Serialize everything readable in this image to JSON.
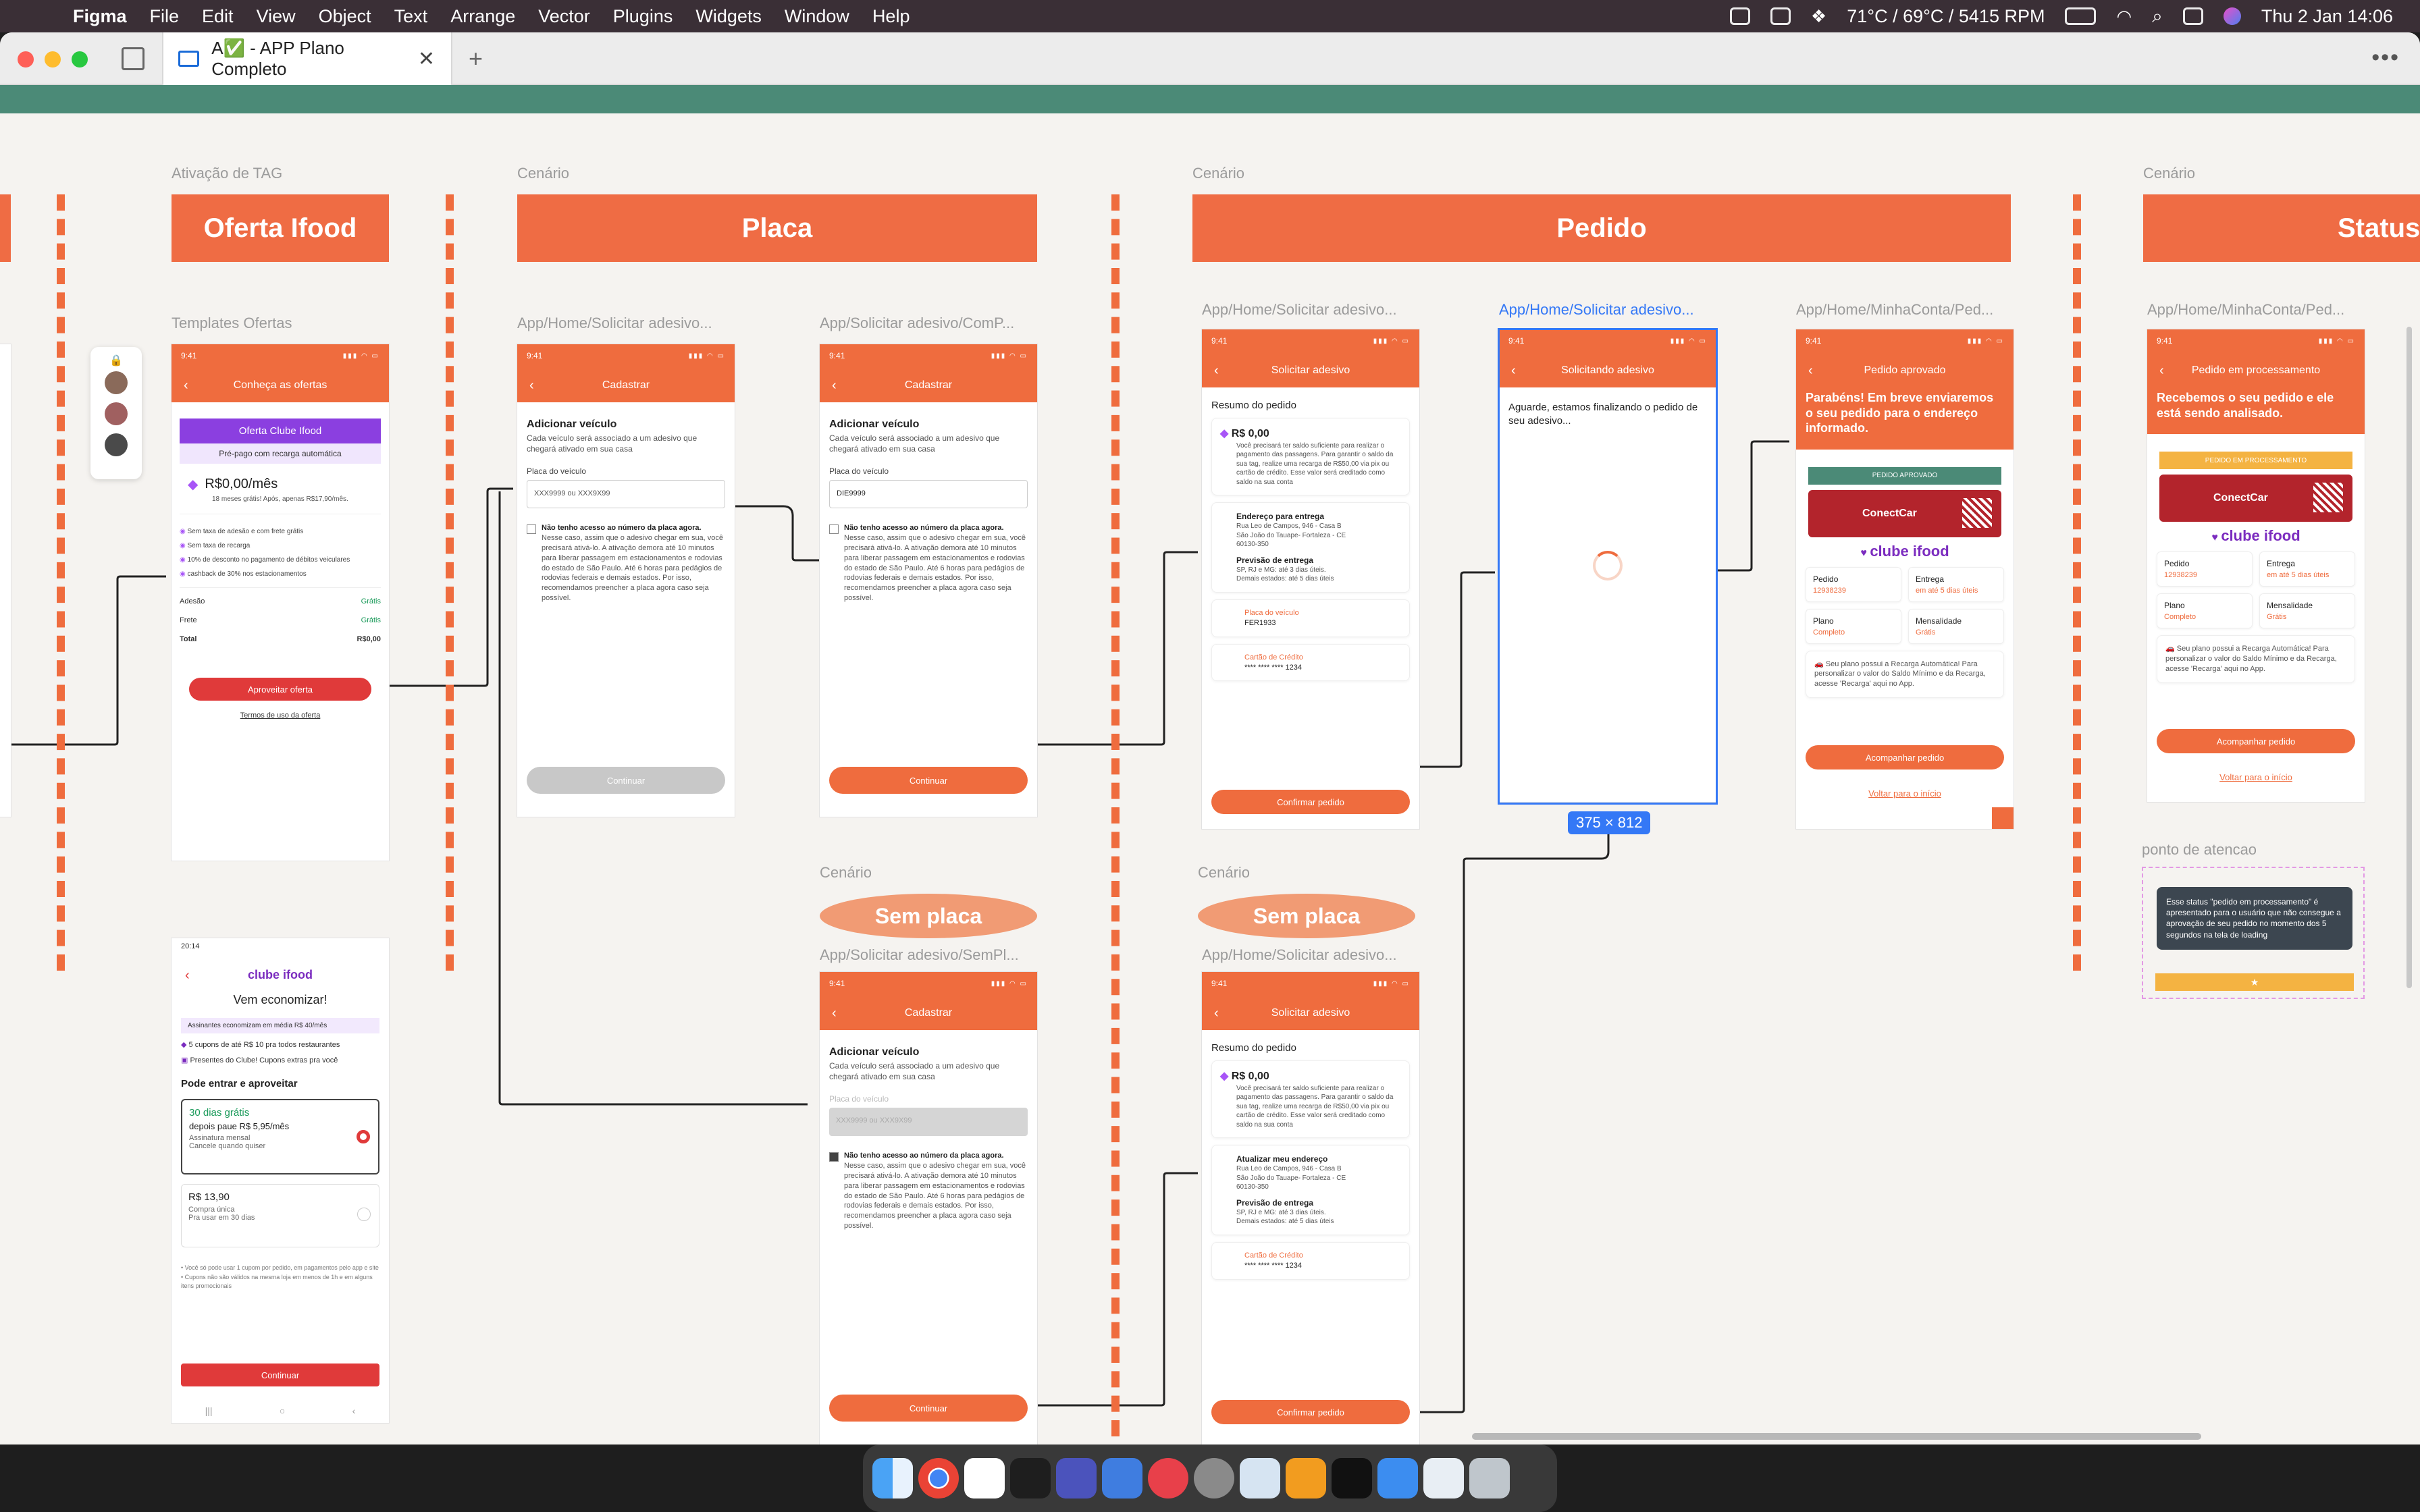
{
  "menubar": {
    "app": "Figma",
    "items": [
      "File",
      "Edit",
      "View",
      "Object",
      "Text",
      "Arrange",
      "Vector",
      "Plugins",
      "Widgets",
      "Window",
      "Help"
    ],
    "temp": "71°C / 69°C / 5415 RPM",
    "datetime": "Thu 2 Jan  14:06"
  },
  "tab": {
    "title": "A✅ - APP Plano Completo"
  },
  "sections": {
    "ativacao_label": "Ativação de TAG",
    "cenario": "Cenário",
    "oferta": "Oferta Ifood",
    "placa": "Placa",
    "pedido": "Pedido",
    "status": "Status do P",
    "sem_placa": "Sem placa",
    "templates": "Templates Ofertas",
    "ponto": "ponto de atencao"
  },
  "frames": {
    "f1": "App/Home/Solicitar adesivo...",
    "f2": "App/Solicitar adesivo/ComP...",
    "f3": "App/Home/Solicitar adesivo...",
    "f4": "App/Home/Solicitar adesivo...",
    "f5": "App/Home/MinhaConta/Ped...",
    "f6": "App/Home/MinhaConta/Ped...",
    "f7": "App/Solicitar adesivo/SemPl...",
    "f8": "App/Home/Solicitar adesivo...",
    "dims": "375 × 812"
  },
  "oferta": {
    "time": "9:41",
    "title": "Conheça as ofertas",
    "banner": "Oferta Clube Ifood",
    "sub": "Pré-pago com recarga automática",
    "price": "R$0,00/mês",
    "price_note": "18 meses grátis! Após, apenas R$17,90/mês.",
    "benefits": [
      "Sem taxa de adesão e com frete grátis",
      "Sem taxa de recarga",
      "10% de desconto no pagamento de débitos veiculares",
      "cashback de 30% nos estacionamentos"
    ],
    "adesao": "Adesão",
    "adesao_v": "Grátis",
    "frete": "Frete",
    "frete_v": "Grátis",
    "total": "Total",
    "total_v": "R$0,00",
    "cta": "Aproveitar oferta",
    "terms": "Termos de uso da oferta"
  },
  "clube": {
    "time": "20:14",
    "logo": "clube ifood",
    "title": "Vem economizar!",
    "saving": "Assinantes economizam em média R$ 40/mês",
    "b1": "5 cupons de até R$ 10 pra todos restaurantes",
    "b2": "Presentes do Clube! Cupons extras pra você",
    "section": "Pode entrar e aproveitar",
    "opt1_t": "30 dias grátis",
    "opt1_s": "depois paue R$ 5,95/mês",
    "opt1_d": "Assinatura mensal\nCancele quando quiser",
    "opt2_t": "R$ 13,90",
    "opt2_d": "Compra única\nPra usar em 30 dias",
    "fine": "• Você só pode usar 1 cupom por pedido, em pagamentos pelo app e site\n• Cupons não são válidos na mesma loja em menos de 1h e em alguns itens promocionais",
    "cta": "Continuar"
  },
  "cadastro": {
    "time": "9:41",
    "title": "Cadastrar",
    "h": "Adicionar veículo",
    "desc": "Cada veículo será associado a um adesivo que chegará ativado em sua casa",
    "field": "Placa do veículo",
    "ph": "XXX9999 ou XXX9X99",
    "val": "DIE9999",
    "chk_b": "Não tenho acesso ao número da placa agora.",
    "chk_t": "Nesse caso, assim que o adesivo chegar em sua, você precisará ativá-lo. A ativação demora até 10 minutos para liberar passagem em estacionamentos e rodovias do estado de São Paulo. Até 6 horas para pedágios de rodovias federais e demais estados. Por isso, recomendamos preencher a placa agora caso seja possível.",
    "cta": "Continuar"
  },
  "resumo": {
    "time": "9:41",
    "title": "Solicitar adesivo",
    "h": "Resumo do pedido",
    "price": "R$ 0,00",
    "price_t": "Você precisará ter saldo suficiente para realizar o pagamento das passagens. Para garantir o saldo da sua tag, realize uma recarga de R$50,00 via pix ou cartão de crédito. Esse valor será creditado como saldo na sua conta",
    "end_t": "Endereço para entrega",
    "end_t2": "Atualizar meu endereço",
    "end": "Rua Leo de Campos, 946 - Casa B\nSão João do Tauape- Fortaleza - CE\n60130-350",
    "prev_t": "Previsão de entrega",
    "prev": "SP, RJ e MG: até 3 dias úteis.\nDemais estados: até 5 dias úteis",
    "placa_t": "Placa do veículo",
    "placa": "FER1933",
    "cartao_t": "Cartão de Crédito",
    "cartao": "**** **** **** 1234",
    "cta": "Confirmar pedido"
  },
  "loading": {
    "time": "9:41",
    "title": "Solicitando adesivo",
    "msg": "Aguarde, estamos finalizando o pedido de seu adesivo..."
  },
  "aprovado": {
    "time": "9:41",
    "title": "Pedido aprovado",
    "msg": "Parabéns! Em breve enviaremos o seu pedido para o endereço informado.",
    "strip": "PEDIDO APROVADO",
    "conect": "ConectCar",
    "clube": "clube ifood",
    "pedido": "Pedido",
    "pedido_v": "12938239",
    "entrega": "Entrega",
    "entrega_v": "em até 5 dias úteis",
    "plano": "Plano",
    "plano_v": "Completo",
    "mens": "Mensalidade",
    "mens_v": "Grátis",
    "info": "Seu plano possui a Recarga Automática! Para personalizar o valor do Saldo Mínimo e da Recarga, acesse 'Recarga' aqui no App.",
    "cta": "Acompanhar pedido",
    "link": "Voltar para o início"
  },
  "processamento": {
    "title": "Pedido em processamento",
    "msg": "Recebemos o seu pedido e ele está sendo analisado.",
    "strip": "PEDIDO EM PROCESSAMENTO"
  },
  "note": {
    "text": "Esse status \"pedido em processamento\" é apresentado para o usuário que não consegue a aprovação de seu pedido no momento dos 5 segundos na tela de loading",
    "star": "★"
  },
  "colors": {
    "accent": "#ef6c3e",
    "selection": "#3478f6",
    "header_green": "#4b8a77"
  }
}
